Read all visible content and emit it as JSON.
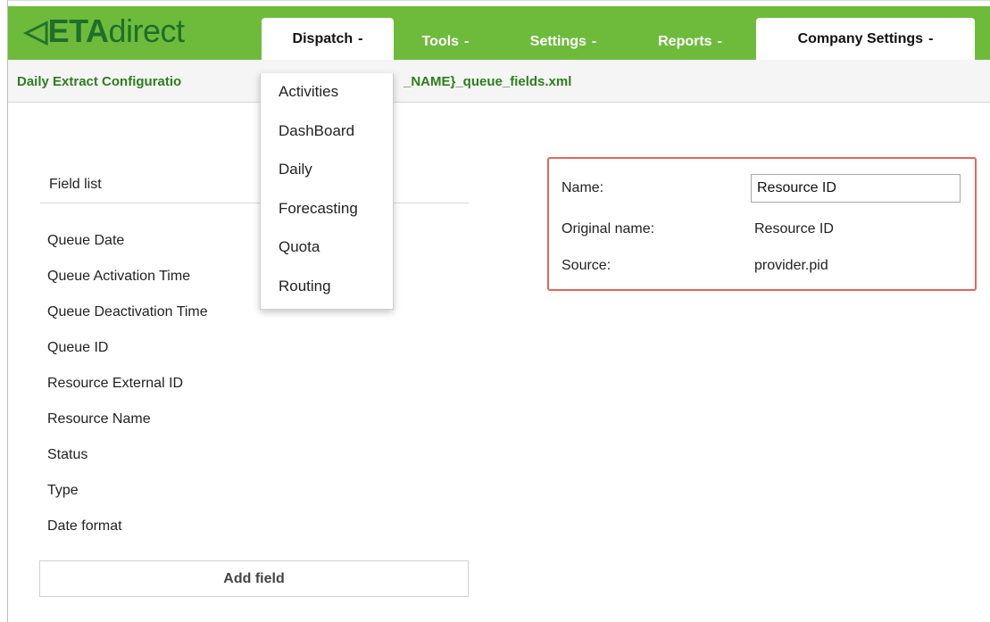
{
  "app": {
    "logo_eta": "ETA",
    "logo_direct": "direct",
    "logo_mark": "◁"
  },
  "nav": {
    "tabs": [
      {
        "label": "Dispatch",
        "caret": "-"
      },
      {
        "label": "Tools",
        "caret": "-"
      },
      {
        "label": "Settings",
        "caret": "-"
      },
      {
        "label": "Reports",
        "caret": "-"
      },
      {
        "label": "Company Settings",
        "caret": "-"
      }
    ],
    "dispatch_menu": [
      "Activities",
      "DashBoard",
      "Daily",
      "Forecasting",
      "Quota",
      "Routing"
    ]
  },
  "breadcrumb": {
    "left": "Daily Extract Configuratio",
    "right": "_NAME}_queue_fields.xml"
  },
  "field_list": {
    "header": "Field list",
    "items": [
      "Queue Date",
      "Queue Activation Time",
      "Queue Deactivation Time",
      "Queue ID",
      "Resource External ID",
      "Resource Name",
      "Status",
      "Type",
      "Date format"
    ],
    "add_button": "Add field"
  },
  "properties": {
    "name_label": "Name:",
    "name_value": "Resource ID",
    "original_label": "Original name:",
    "original_value": "Resource ID",
    "source_label": "Source:",
    "source_value": "provider.pid"
  },
  "colors": {
    "nav_green": "#6ebb3c",
    "logo_green": "#1f6e29",
    "breadcrumb_green": "#2e7d1f",
    "highlight_red": "#e2665e"
  }
}
